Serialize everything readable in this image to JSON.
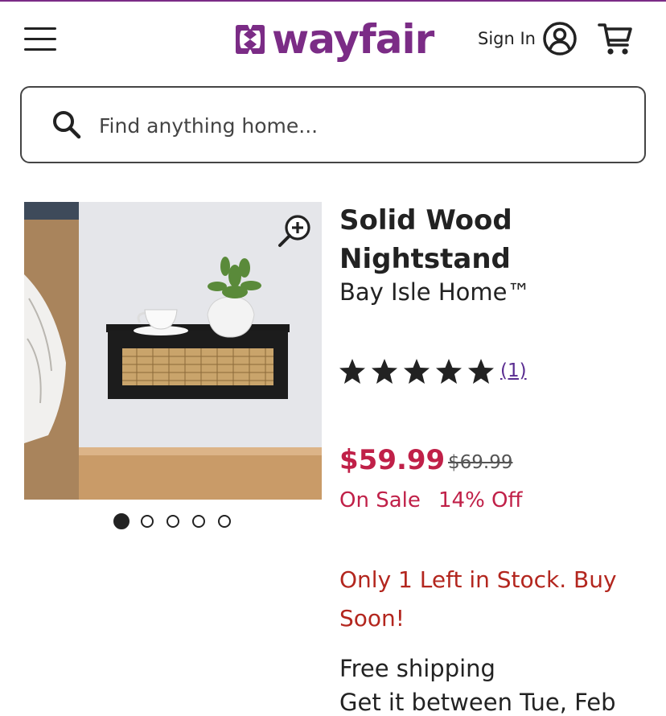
{
  "header": {
    "logo_text": "wayfair",
    "sign_in_label": "Sign In",
    "menu_icon": "hamburger-menu-icon",
    "account_icon": "user-circle-icon",
    "cart_icon": "shopping-cart-icon",
    "brand_color": "#7b2c86"
  },
  "search": {
    "placeholder": "Find anything home...",
    "icon": "search-icon"
  },
  "product": {
    "title": "Solid Wood Nightstand",
    "brand": "Bay Isle Home™",
    "rating": 5,
    "review_count": "(1)",
    "price": "$59.99",
    "was_price": "$69.99",
    "sale_label": "On Sale",
    "discount_label": "14% Off",
    "stock_message": "Only 1 Left in Stock. Buy Soon!",
    "shipping_label": "Free shipping",
    "delivery_text": "Get it between Tue, Feb",
    "price_color": "#c02048",
    "stock_color": "#b3261e"
  },
  "gallery": {
    "image_count": 5,
    "active_index": 0,
    "zoom_icon": "zoom-in-icon"
  }
}
